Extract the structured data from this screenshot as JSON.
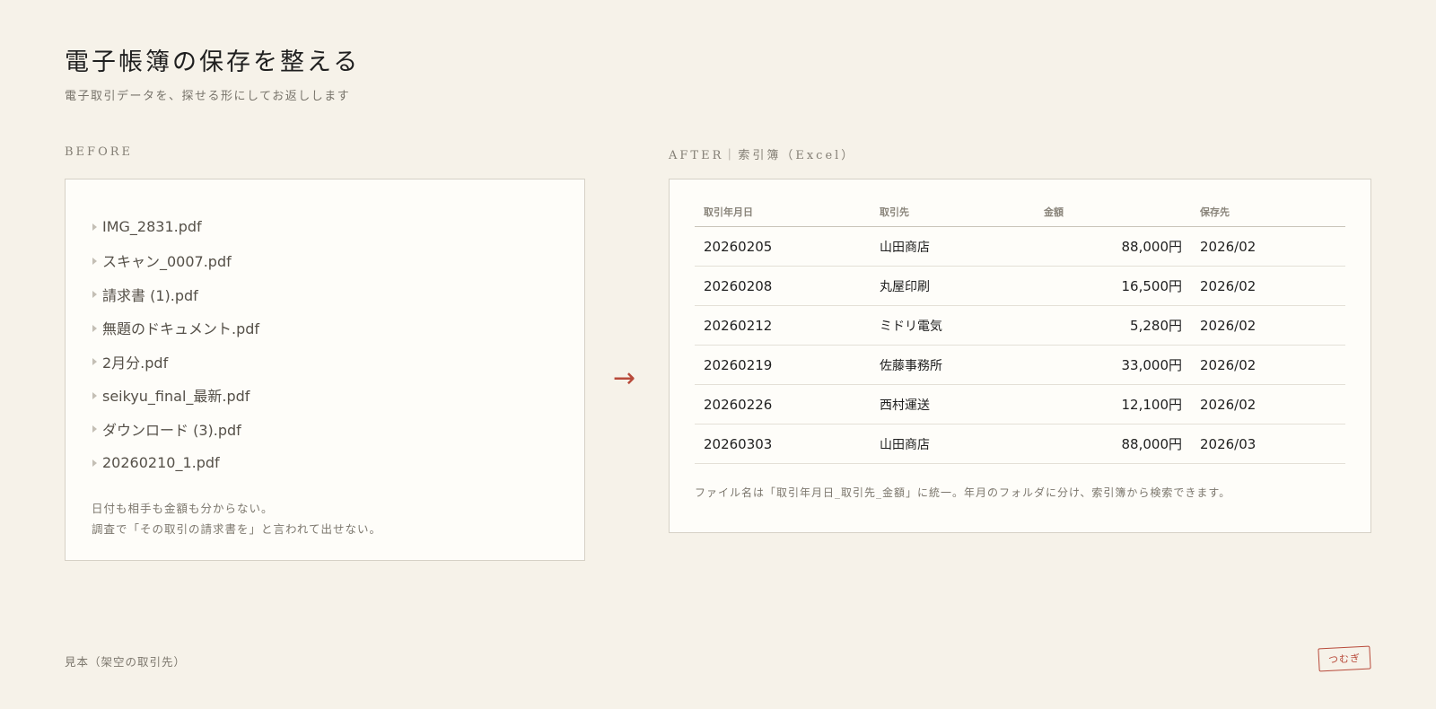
{
  "header": {
    "title": "電子帳簿の保存を整える",
    "subtitle": "電子取引データを、探せる形にしてお返しします"
  },
  "before": {
    "label": "BEFORE",
    "files": [
      "IMG_2831.pdf",
      "スキャン_0007.pdf",
      "請求書 (1).pdf",
      "無題のドキュメント.pdf",
      "2月分.pdf",
      "seikyu_final_最新.pdf",
      "ダウンロード (3).pdf",
      "20260210_1.pdf"
    ],
    "note_lines": [
      "日付も相手も金額も分からない。",
      "調査で「その取引の請求書を」と言われて出せない。"
    ]
  },
  "arrow": "→",
  "after": {
    "label": "AFTER｜索引簿（Excel）",
    "columns": [
      "取引年月日",
      "取引先",
      "金額",
      "保存先"
    ],
    "rows": [
      [
        "20260205",
        "山田商店",
        "88,000円",
        "2026/02"
      ],
      [
        "20260208",
        "丸屋印刷",
        "16,500円",
        "2026/02"
      ],
      [
        "20260212",
        "ミドリ電気",
        "5,280円",
        "2026/02"
      ],
      [
        "20260219",
        "佐藤事務所",
        "33,000円",
        "2026/02"
      ],
      [
        "20260226",
        "西村運送",
        "12,100円",
        "2026/02"
      ],
      [
        "20260303",
        "山田商店",
        "88,000円",
        "2026/03"
      ]
    ],
    "note": "ファイル名は「取引年月日_取引先_金額」に統一。年月のフォルダに分け、索引簿から検索できます。"
  },
  "footer": {
    "note": "見本（架空の取引先）",
    "stamp": "つむぎ"
  },
  "colors": {
    "background": "#f6f2e9",
    "panel": "#fefdf9",
    "accent": "#b84a3a"
  }
}
